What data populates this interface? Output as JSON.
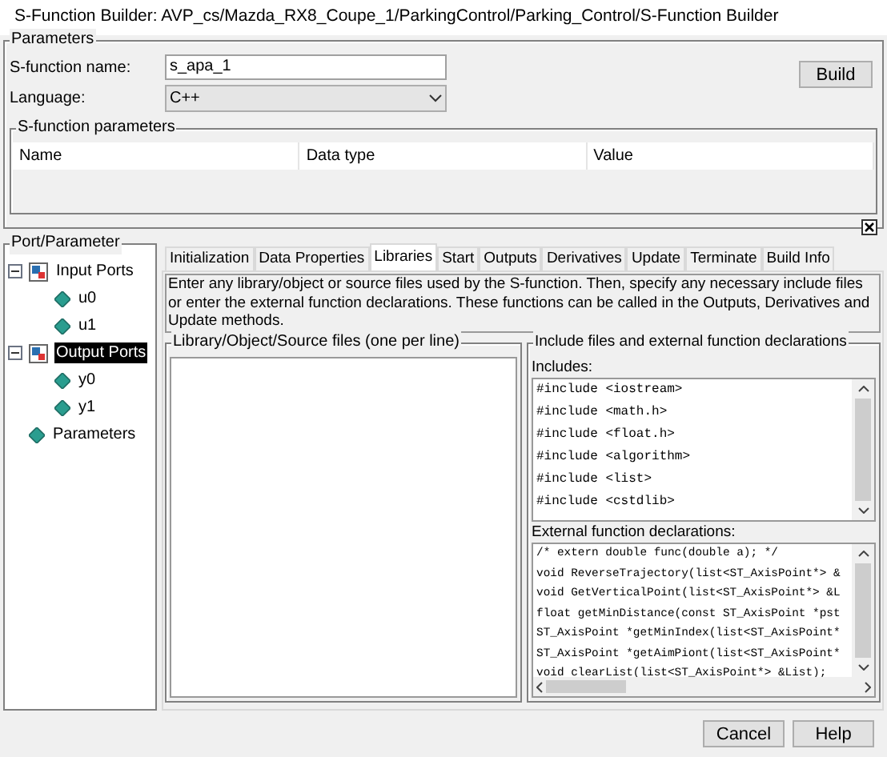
{
  "window": {
    "title": "S-Function Builder: AVP_cs/Mazda_RX8_Coupe_1/ParkingControl/Parking_Control/S-Function Builder"
  },
  "parameters": {
    "title": "Parameters",
    "name_label": "S-function name:",
    "name_value": "s_apa_1",
    "language_label": "Language:",
    "language_value": "C++",
    "build_button": "Build",
    "sfunction_parameters": {
      "title": "S-function parameters",
      "columns": [
        "Name",
        "Data type",
        "Value"
      ]
    }
  },
  "port_parameter": {
    "title": "Port/Parameter",
    "tree": [
      {
        "label": "Input Ports",
        "kind": "group",
        "expanded": true,
        "selected": false,
        "children": [
          {
            "label": "u0",
            "kind": "port",
            "selected": false
          },
          {
            "label": "u1",
            "kind": "port",
            "selected": false
          }
        ]
      },
      {
        "label": "Output Ports",
        "kind": "group",
        "expanded": true,
        "selected": true,
        "children": [
          {
            "label": "y0",
            "kind": "port",
            "selected": false
          },
          {
            "label": "y1",
            "kind": "port",
            "selected": false
          }
        ]
      },
      {
        "label": "Parameters",
        "kind": "port",
        "selected": false
      }
    ]
  },
  "tabs": [
    {
      "label": "Initialization",
      "selected": false
    },
    {
      "label": "Data Properties",
      "selected": false
    },
    {
      "label": "Libraries",
      "selected": true
    },
    {
      "label": "Start",
      "selected": false
    },
    {
      "label": "Outputs",
      "selected": false
    },
    {
      "label": "Derivatives",
      "selected": false
    },
    {
      "label": "Update",
      "selected": false
    },
    {
      "label": "Terminate",
      "selected": false
    },
    {
      "label": "Build Info",
      "selected": false
    }
  ],
  "description": "Enter any library/object or source files used by the S-function. Then, specify any necessary include files or enter the external function declarations. These functions can be called in the Outputs, Derivatives and Update methods.",
  "library_files": {
    "title": "Library/Object/Source files (one per line)"
  },
  "include_section": {
    "title": "Include files and external function declarations",
    "includes_label": "Includes:",
    "includes": [
      "#include <iostream>",
      "#include <math.h>",
      "#include <float.h>",
      "#include <algorithm>",
      "#include <list>",
      "#include <cstdlib>"
    ],
    "external_label": "External function declarations:",
    "external": [
      "/* extern double func(double a); */",
      "void ReverseTrajectory(list<ST_AxisPoint*> &",
      "void GetVerticalPoint(list<ST_AxisPoint*> &L",
      "float getMinDistance(const ST_AxisPoint *pst",
      "ST_AxisPoint *getMinIndex(list<ST_AxisPoint*",
      "ST_AxisPoint *getAimPiont(list<ST_AxisPoint*",
      "void clearList(list<ST_AxisPoint*> &List);"
    ]
  },
  "buttons": [
    "Cancel",
    "Help"
  ]
}
